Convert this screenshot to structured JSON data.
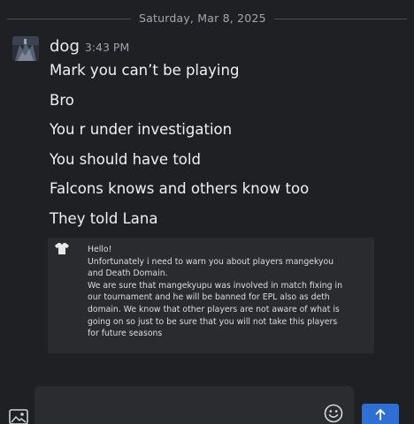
{
  "date_divider": "Saturday, Mar 8, 2025",
  "message": {
    "username": "dog",
    "timestamp": "3:43 PM",
    "lines": [
      "Mark you can’t be playing",
      "Bro",
      "You r under investigation",
      "You should have told",
      "Falcons knows and others know too",
      "They told Lana"
    ]
  },
  "attachment": {
    "lines": [
      "Hello!",
      "Unfortunately i need to warn you about players  mangekyou",
      "and  Death Domain.",
      "We are sure that mangekyupu was involved in match fixing in",
      "our tournament and he will be banned for EPL also as deth",
      "domain. We know that other players are not aware of what is",
      "going on so just to be sure that you will not take this players",
      "for future seasons"
    ]
  },
  "composer": {
    "placeholder": "",
    "send_icon": "arrow-up-icon",
    "emoji_icon": "smiley-icon",
    "image_icon": "image-icon"
  },
  "colors": {
    "background": "#1f2023",
    "attachment_bg": "#2a2b2f",
    "send_button": "#2f6fd4"
  }
}
